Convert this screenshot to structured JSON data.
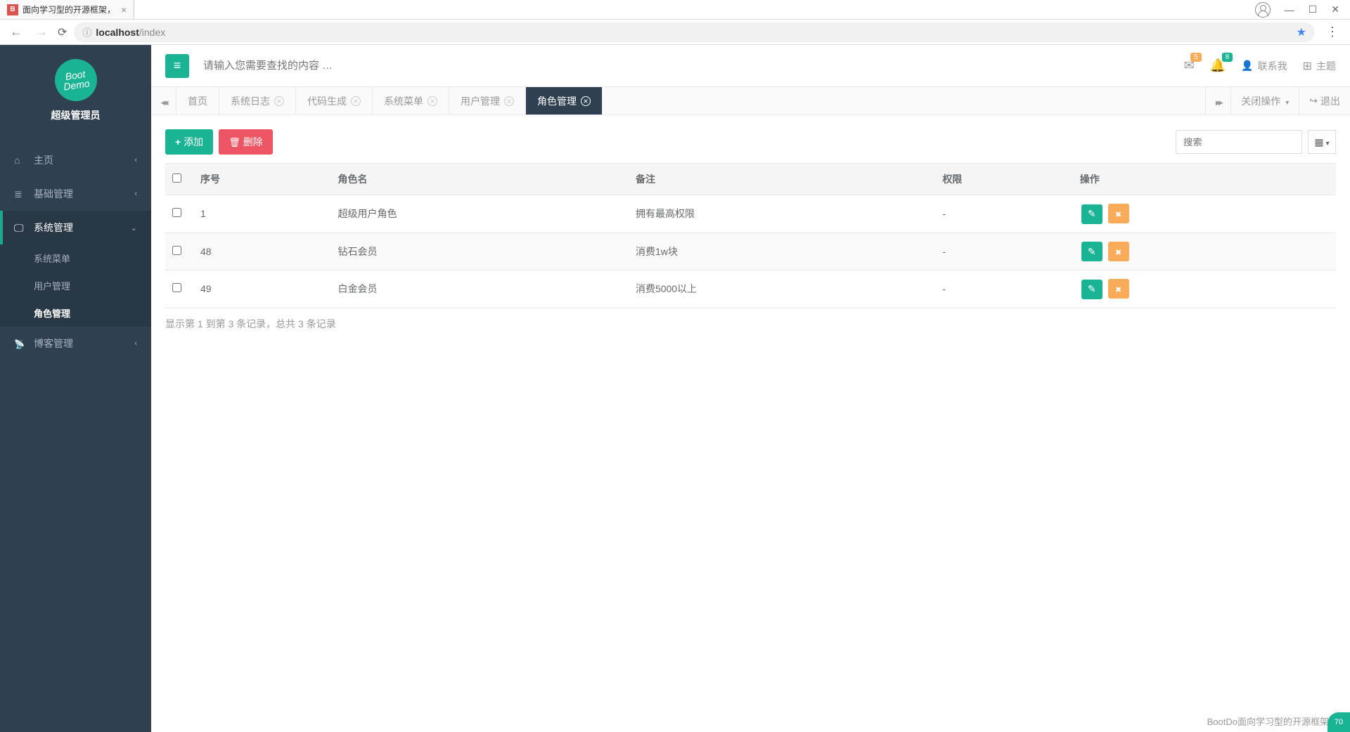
{
  "browser": {
    "tab_title": "面向学习型的开源框架，",
    "url_host": "localhost",
    "url_path": "/index"
  },
  "sidebar": {
    "logo_text": "Boot Demo",
    "role": "超级管理员",
    "items": [
      {
        "icon": "ic-home",
        "label": "主页"
      },
      {
        "icon": "ic-list",
        "label": "基础管理"
      },
      {
        "icon": "ic-desktop",
        "label": "系统管理"
      },
      {
        "icon": "ic-rss",
        "label": "博客管理"
      }
    ],
    "sub_system": [
      {
        "label": "系统菜单"
      },
      {
        "label": "用户管理"
      },
      {
        "label": "角色管理"
      }
    ]
  },
  "topbar": {
    "search_placeholder": "请输入您需要查找的内容 …",
    "badge_mail": "5",
    "badge_bell": "8",
    "contact": "联系我",
    "theme": "主题"
  },
  "tabs": {
    "items": [
      {
        "label": "首页",
        "closable": false
      },
      {
        "label": "系统日志",
        "closable": true
      },
      {
        "label": "代码生成",
        "closable": true
      },
      {
        "label": "系统菜单",
        "closable": true
      },
      {
        "label": "用户管理",
        "closable": true
      },
      {
        "label": "角色管理",
        "closable": true
      }
    ],
    "close_ops": "关闭操作",
    "logout": "退出"
  },
  "toolbar": {
    "add_label": "添加",
    "delete_label": "删除",
    "search_placeholder": "搜索"
  },
  "table": {
    "headers": {
      "seq": "序号",
      "role_name": "角色名",
      "remark": "备注",
      "permission": "权限",
      "ops": "操作"
    },
    "rows": [
      {
        "seq": "1",
        "role_name": "超级用户角色",
        "remark": "拥有最高权限",
        "permission": "-"
      },
      {
        "seq": "48",
        "role_name": "钻石会员",
        "remark": "消费1w块",
        "permission": "-"
      },
      {
        "seq": "49",
        "role_name": "白金会员",
        "remark": "消费5000以上",
        "permission": "-"
      }
    ],
    "info": "显示第 1 到第 3 条记录，总共 3 条记录"
  },
  "footer": {
    "note": "BootDo面向学习型的开源框架",
    "float": "70"
  }
}
